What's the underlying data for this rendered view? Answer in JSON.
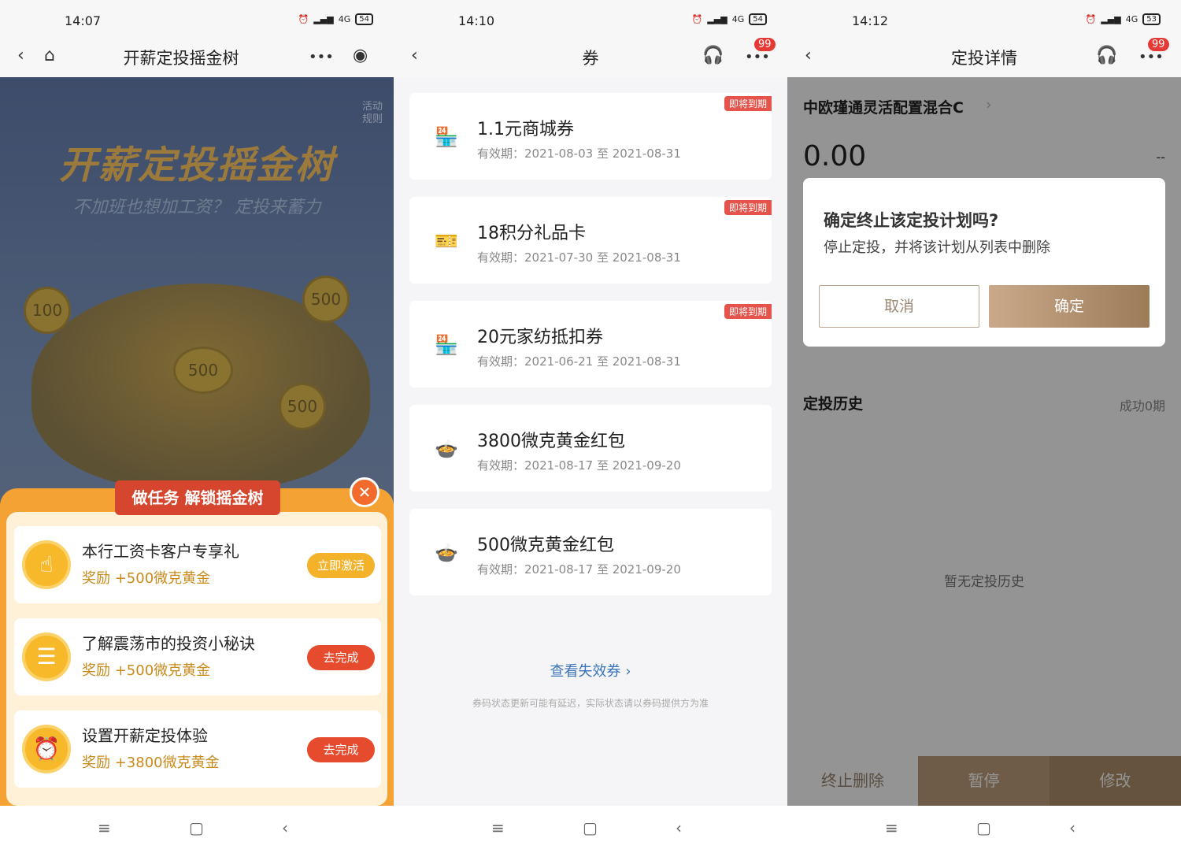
{
  "p1": {
    "time": "14:07",
    "battery": "54",
    "network": "4G",
    "title": "开薪定投摇金树",
    "rules": "活动规则",
    "banner_title": "开薪定投摇金树",
    "banner_subtitle": "不加班也想加工资？ 定投来蓄力",
    "coins": [
      "100",
      "500",
      "500",
      "500"
    ],
    "ribbon": "做任务 解锁摇金树",
    "tasks": [
      {
        "name": "本行工资卡客户专享礼",
        "reward": "奖励 +500微克黄金",
        "button": "立即激活",
        "icon": "☝"
      },
      {
        "name": "了解震荡市的投资小秘诀",
        "reward": "奖励 +500微克黄金",
        "button": "去完成",
        "icon": "☰"
      },
      {
        "name": "设置开薪定投体验",
        "reward": "奖励 +3800微克黄金",
        "button": "去完成",
        "icon": "⏰"
      }
    ],
    "colors": {
      "activate": "#f3b22a",
      "complete": "#e64b2e"
    }
  },
  "p2": {
    "time": "14:10",
    "battery": "54",
    "network": "4G",
    "title": "券",
    "badge": "99",
    "coupons": [
      {
        "name": "1.1元商城券",
        "date": "有效期：2021-08-03 至 2021-08-31",
        "tag": "即将到期",
        "icon": "🏪"
      },
      {
        "name": "18积分礼品卡",
        "date": "有效期：2021-07-30 至 2021-08-31",
        "tag": "即将到期",
        "icon": "🎫"
      },
      {
        "name": "20元家纺抵扣券",
        "date": "有效期：2021-06-21 至 2021-08-31",
        "tag": "即将到期",
        "icon": "🏪"
      },
      {
        "name": "3800微克黄金红包",
        "date": "有效期：2021-08-17 至 2021-09-20",
        "tag": "",
        "icon": "🍲"
      },
      {
        "name": "500微克黄金红包",
        "date": "有效期：2021-08-17 至 2021-09-20",
        "tag": "",
        "icon": "🍲"
      }
    ],
    "view_invalid": "查看失效券 ›",
    "notice": "券码状态更新可能有延迟，实际状态请以券码提供方为准"
  },
  "p3": {
    "time": "14:12",
    "battery": "53",
    "network": "4G",
    "title": "定投详情",
    "badge": "99",
    "fund_name": "中欧瑾通灵活配置混合C",
    "amount": "0.00",
    "dash": "--",
    "dialog": {
      "title": "确定终止该定投计划吗?",
      "message": "停止定投，并将该计划从列表中删除",
      "cancel": "取消",
      "confirm": "确定"
    },
    "history_title": "定投历史",
    "history_count": "成功0期",
    "history_empty": "暂无定投历史",
    "buttons": {
      "delete": "终止删除",
      "pause": "暂停",
      "modify": "修改"
    }
  },
  "sysnav": {
    "menu": "≡",
    "home": "▢",
    "back": "‹"
  }
}
